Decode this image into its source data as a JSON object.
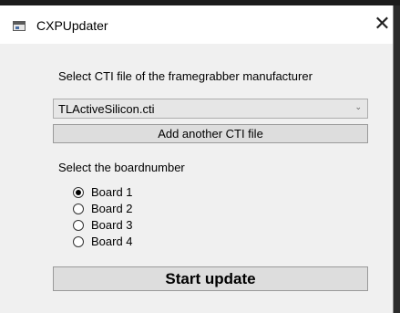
{
  "window": {
    "title": "CXPUpdater",
    "close_glyph": "✕"
  },
  "cti": {
    "prompt": "Select CTI file of the framegrabber manufacturer",
    "selected_value": "TLActiveSilicon.cti",
    "add_button_label": "Add another CTI file"
  },
  "board": {
    "prompt": "Select the boardnumber",
    "options": [
      {
        "label": "Board 1",
        "checked": true
      },
      {
        "label": "Board 2",
        "checked": false
      },
      {
        "label": "Board 3",
        "checked": false
      },
      {
        "label": "Board 4",
        "checked": false
      }
    ]
  },
  "actions": {
    "start_label": "Start update"
  }
}
